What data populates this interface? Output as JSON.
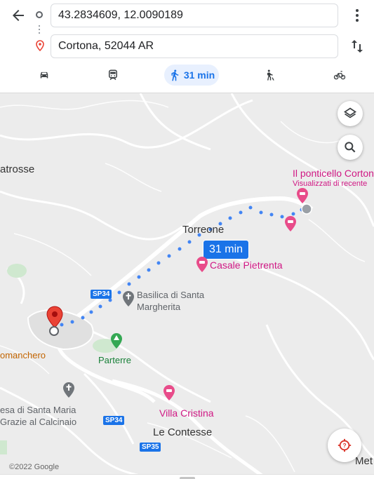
{
  "directions": {
    "origin_value": "43.2834609, 12.0090189",
    "destination_value": "Cortona, 52044 AR"
  },
  "icons": {
    "back": "arrow-left-icon",
    "origin": "origin-circle-icon",
    "destination": "destination-pin-icon",
    "more": "more-vert-icon",
    "swap": "swap-vert-icon"
  },
  "travel_modes": [
    {
      "mode": "drive",
      "icon": "car-icon",
      "active": false
    },
    {
      "mode": "transit",
      "icon": "train-icon",
      "active": false
    },
    {
      "mode": "walk",
      "icon": "walk-icon",
      "active": true,
      "duration": "31 min"
    },
    {
      "mode": "ride",
      "icon": "ride-icon",
      "active": false
    },
    {
      "mode": "bike",
      "icon": "bike-icon",
      "active": false
    }
  ],
  "map": {
    "route_badge": "31 min",
    "labels": {
      "atrosse": "atrosse",
      "il_ponticello": "Il ponticello Corton",
      "visualizzati": "Visualizzati di recente",
      "torreone": "Torreone",
      "casale": "Casale Pietrenta",
      "basilica_1": "Basilica di Santa",
      "basilica_2": "Margherita",
      "parterre": "Parterre",
      "omanchero": "omanchero",
      "santa_maria_1": "esa di Santa Maria",
      "santa_maria_2": "Grazie al Calcinaio",
      "villa_cristina": "Villa Cristina",
      "le_contesse": "Le Contesse",
      "met": "Met"
    },
    "roads": {
      "sp34_a": "SP34",
      "sp34_b": "SP34",
      "sp35": "SP35"
    },
    "copyright": "©2022 Google",
    "controls": [
      "layers-icon",
      "search-icon",
      "location-help-icon"
    ],
    "colors": {
      "route": "#1a73e8",
      "poi": "#d01884",
      "park": "#188038",
      "pin": "#ea4335"
    }
  }
}
